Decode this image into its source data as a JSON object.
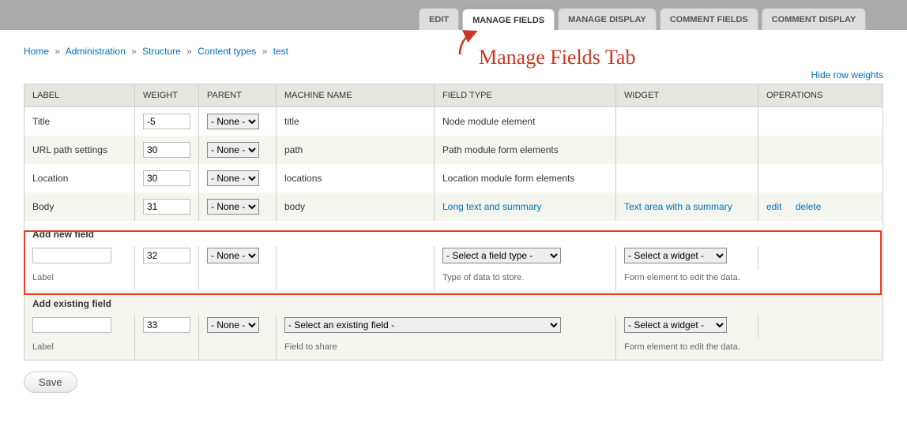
{
  "tabs": {
    "edit": "EDIT",
    "manage_fields": "MANAGE FIELDS",
    "manage_display": "MANAGE DISPLAY",
    "comment_fields": "COMMENT FIELDS",
    "comment_display": "COMMENT DISPLAY"
  },
  "breadcrumb": {
    "home": "Home",
    "admin": "Administration",
    "structure": "Structure",
    "content_types": "Content types",
    "last": "test",
    "sep": "»"
  },
  "links": {
    "hide_row_weights": "Hide row weights"
  },
  "columns": {
    "label": "LABEL",
    "weight": "WEIGHT",
    "parent": "PARENT",
    "machine": "MACHINE NAME",
    "field_type": "FIELD TYPE",
    "widget": "WIDGET",
    "operations": "OPERATIONS"
  },
  "parent_option": "- None -",
  "rows": {
    "title": {
      "label": "Title",
      "weight": "-5",
      "machine": "title",
      "field_type": "Node module element"
    },
    "path": {
      "label": "URL path settings",
      "weight": "30",
      "machine": "path",
      "field_type": "Path module form elements"
    },
    "location": {
      "label": "Location",
      "weight": "30",
      "machine": "locations",
      "field_type": "Location module form elements"
    },
    "body": {
      "label": "Body",
      "weight": "31",
      "machine": "body",
      "field_type": "Long text and summary",
      "widget": "Text area with a summary",
      "op_edit": "edit",
      "op_delete": "delete"
    }
  },
  "add_new": {
    "heading": "Add new field",
    "weight": "32",
    "label_desc": "Label",
    "type_placeholder": "- Select a field type -",
    "type_desc": "Type of data to store.",
    "widget_placeholder": "- Select a widget -",
    "widget_desc": "Form element to edit the data."
  },
  "add_existing": {
    "heading": "Add existing field",
    "weight": "33",
    "label_desc": "Label",
    "field_placeholder": "- Select an existing field -",
    "field_desc": "Field to share",
    "widget_placeholder": "- Select a widget -",
    "widget_desc": "Form element to edit the data."
  },
  "buttons": {
    "save": "Save"
  },
  "annotation": {
    "text": "Manage Fields Tab"
  }
}
